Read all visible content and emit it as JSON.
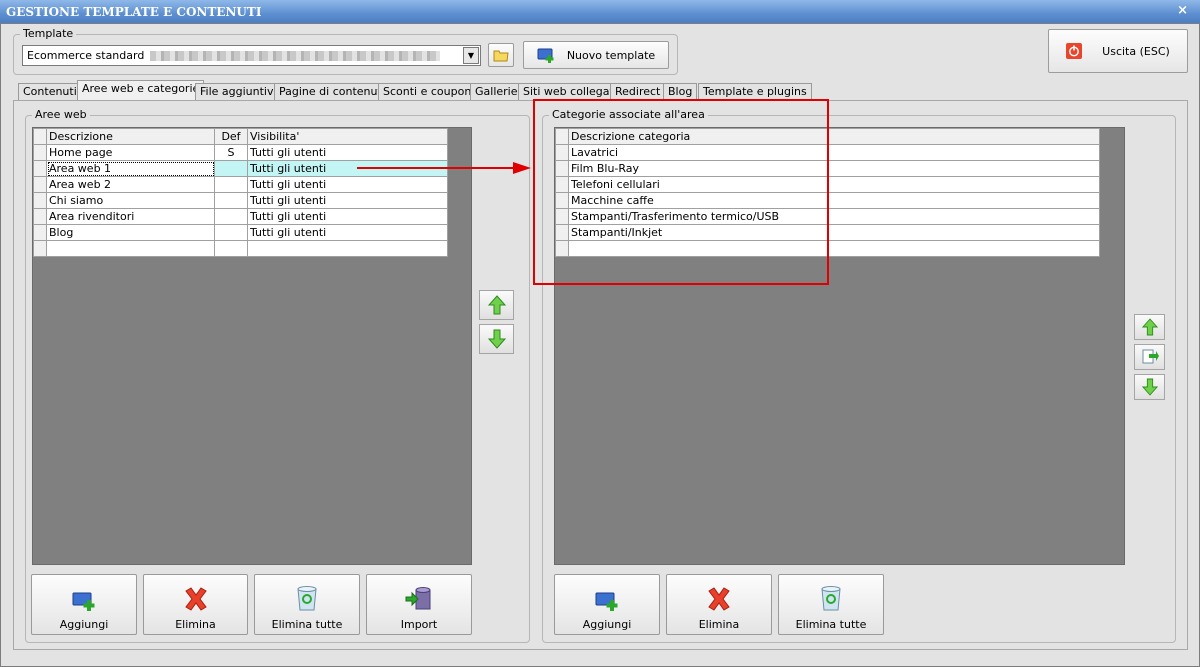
{
  "window": {
    "title": "GESTIONE TEMPLATE E CONTENUTI",
    "close": "×"
  },
  "template": {
    "group_label": "Template",
    "selected": "Ecommerce standard",
    "new_button": "Nuovo template"
  },
  "exit_button": "Uscita (ESC)",
  "tabs": [
    "Contenuti",
    "Aree web e categorie",
    "File aggiuntivi",
    "Pagine di contenuti",
    "Sconti e coupon",
    "Gallerie",
    "Siti web collegati",
    "Redirect",
    "Blog",
    "Template e plugins"
  ],
  "active_tab": 1,
  "aree_web": {
    "group_label": "Aree web",
    "columns": [
      "Descrizione",
      "Def",
      "Visibilita'"
    ],
    "rows": [
      {
        "descrizione": "Home page",
        "def": "S",
        "visibilita": "Tutti gli utenti"
      },
      {
        "descrizione": "Area web 1",
        "def": "",
        "visibilita": "Tutti gli utenti"
      },
      {
        "descrizione": "Area web 2",
        "def": "",
        "visibilita": "Tutti gli utenti"
      },
      {
        "descrizione": "Chi siamo",
        "def": "",
        "visibilita": "Tutti gli utenti"
      },
      {
        "descrizione": "Area rivenditori",
        "def": "",
        "visibilita": "Tutti gli utenti"
      },
      {
        "descrizione": "Blog",
        "def": "",
        "visibilita": "Tutti gli utenti"
      }
    ],
    "selected_row": 1,
    "buttons": {
      "add": "Aggiungi",
      "delete": "Elimina",
      "delete_all": "Elimina tutte",
      "import": "Import"
    }
  },
  "categorie": {
    "group_label": "Categorie associate all'area",
    "columns": [
      "Descrizione categoria"
    ],
    "rows": [
      "Lavatrici",
      "Film Blu-Ray",
      "Telefoni cellulari",
      "Macchine caffe",
      "Stampanti/Trasferimento termico/USB",
      "Stampanti/Inkjet"
    ],
    "buttons": {
      "add": "Aggiungi",
      "delete": "Elimina",
      "delete_all": "Elimina tutte"
    }
  },
  "colors": {
    "highlight_box": "#e00000",
    "arrow": "#e00000",
    "grid_bg": "#808080",
    "selection": "#c4f5f5"
  },
  "icons": [
    "close-icon",
    "dropdown-arrow-icon",
    "folder-icon",
    "add-template-icon",
    "power-icon",
    "arrow-up-icon",
    "arrow-down-icon",
    "swap-icon",
    "add-icon",
    "delete-x-icon",
    "recycle-bin-icon",
    "database-import-icon"
  ]
}
